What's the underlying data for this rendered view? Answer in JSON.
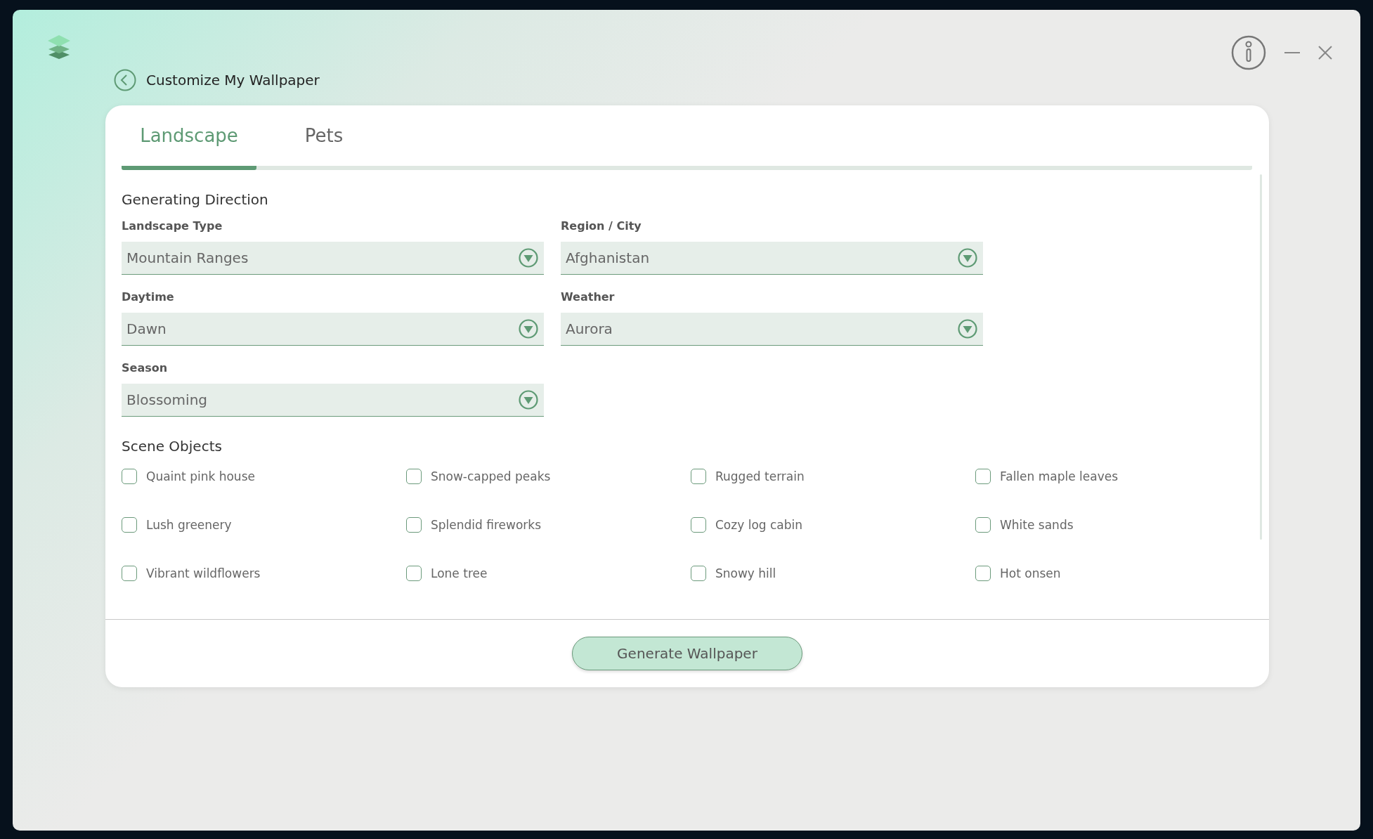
{
  "header": {
    "title": "Customize My Wallpaper"
  },
  "tabs": [
    {
      "label": "Landscape",
      "selected": true
    },
    {
      "label": "Pets",
      "selected": false
    }
  ],
  "section_title": "Generating Direction",
  "fields": [
    {
      "label": "Landscape Type",
      "value": "Mountain Ranges"
    },
    {
      "label": "Region / City",
      "value": "Afghanistan"
    },
    {
      "label": "Daytime",
      "value": "Dawn"
    },
    {
      "label": "Weather",
      "value": "Aurora"
    },
    {
      "label": "Season",
      "value": "Blossoming"
    }
  ],
  "scene_objects": {
    "title": "Scene Objects",
    "items": [
      {
        "label": "Quaint pink house",
        "checked": false
      },
      {
        "label": "Snow-capped peaks",
        "checked": false
      },
      {
        "label": "Rugged terrain",
        "checked": false
      },
      {
        "label": "Fallen maple leaves",
        "checked": false
      },
      {
        "label": "Lush greenery",
        "checked": false
      },
      {
        "label": "Splendid fireworks",
        "checked": false
      },
      {
        "label": "Cozy log cabin",
        "checked": false
      },
      {
        "label": "White sands",
        "checked": false
      },
      {
        "label": "Vibrant wildflowers",
        "checked": false
      },
      {
        "label": "Lone tree",
        "checked": false
      },
      {
        "label": "Snowy hill",
        "checked": false
      },
      {
        "label": "Hot onsen",
        "checked": false
      }
    ]
  },
  "button": "Generate Wallpaper"
}
